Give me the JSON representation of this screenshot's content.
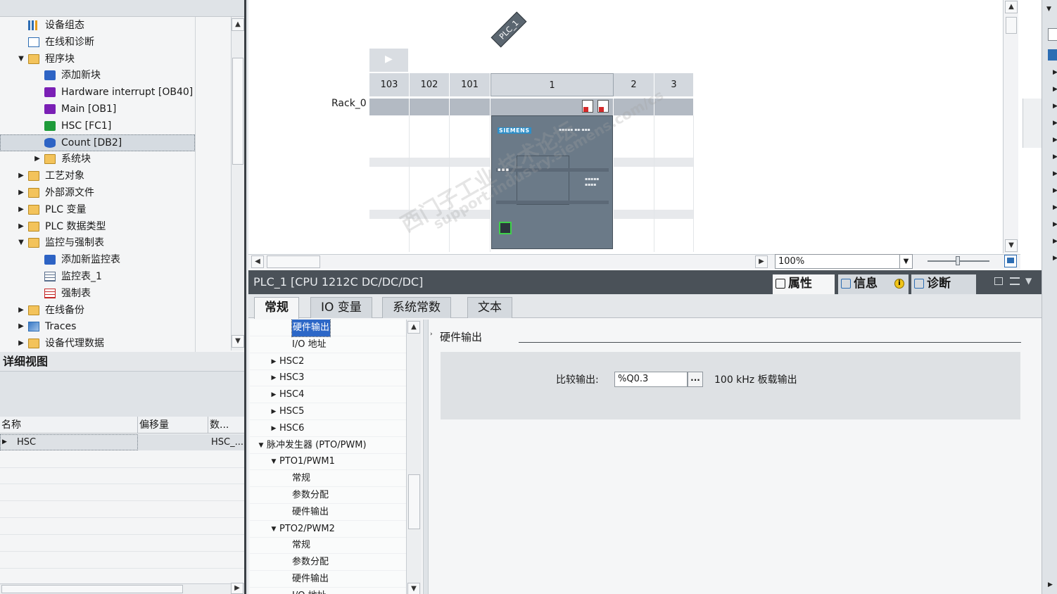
{
  "project_tree": {
    "items": [
      {
        "label": "设备组态",
        "icon": "device-configuration-icon"
      },
      {
        "label": "在线和诊断",
        "icon": "online-diagnostics-icon"
      },
      {
        "label": "程序块",
        "icon": "folder-icon",
        "expanded": true
      },
      {
        "label": "添加新块",
        "icon": "add-block-icon"
      },
      {
        "label": "Hardware interrupt [OB40]",
        "icon": "ob-block-icon"
      },
      {
        "label": "Main [OB1]",
        "icon": "ob-block-icon"
      },
      {
        "label": "HSC [FC1]",
        "icon": "fc-block-icon"
      },
      {
        "label": "Count [DB2]",
        "icon": "db-block-icon",
        "selected": true
      },
      {
        "label": "系统块",
        "icon": "folder-icon"
      },
      {
        "label": "工艺对象",
        "icon": "folder-icon"
      },
      {
        "label": "外部源文件",
        "icon": "folder-icon"
      },
      {
        "label": "PLC 变量",
        "icon": "folder-icon"
      },
      {
        "label": "PLC 数据类型",
        "icon": "folder-icon"
      },
      {
        "label": "监控与强制表",
        "icon": "folder-icon",
        "expanded": true
      },
      {
        "label": "添加新监控表",
        "icon": "add-watch-table-icon"
      },
      {
        "label": "监控表_1",
        "icon": "watch-table-icon"
      },
      {
        "label": "强制表",
        "icon": "force-table-icon"
      },
      {
        "label": "在线备份",
        "icon": "folder-icon"
      },
      {
        "label": "Traces",
        "icon": "traces-icon"
      },
      {
        "label": "设备代理数据",
        "icon": "folder-icon"
      }
    ]
  },
  "detail_view": {
    "title": "详细视图",
    "columns": [
      "名称",
      "偏移量",
      "数..."
    ],
    "rows": [
      {
        "name": "HSC",
        "offset": "",
        "data": "HSC_..."
      }
    ]
  },
  "device_view": {
    "plc_tag": "PLC_1",
    "rack_label": "Rack_0",
    "slots": [
      "103",
      "102",
      "101",
      "1",
      "2",
      "3"
    ],
    "cpu_brand": "SIEMENS",
    "zoom": "100%"
  },
  "inspector": {
    "title": "PLC_1 [CPU 1212C DC/DC/DC]",
    "panel_tabs": [
      "属性",
      "信息",
      "诊断"
    ],
    "sub_tabs": [
      "常规",
      "IO 变量",
      "系统常数",
      "文本"
    ],
    "nav_items": [
      {
        "label": "硬件输出",
        "level": 3,
        "selected": true
      },
      {
        "label": "I/O 地址",
        "level": 3
      },
      {
        "label": "HSC2",
        "level": 2,
        "toggle": "▶"
      },
      {
        "label": "HSC3",
        "level": 2,
        "toggle": "▶"
      },
      {
        "label": "HSC4",
        "level": 2,
        "toggle": "▶"
      },
      {
        "label": "HSC5",
        "level": 2,
        "toggle": "▶"
      },
      {
        "label": "HSC6",
        "level": 2,
        "toggle": "▶"
      },
      {
        "label": "脉冲发生器 (PTO/PWM)",
        "level": 1,
        "toggle": "▼"
      },
      {
        "label": "PTO1/PWM1",
        "level": 2,
        "toggle": "▼"
      },
      {
        "label": "常规",
        "level": 3
      },
      {
        "label": "参数分配",
        "level": 3
      },
      {
        "label": "硬件输出",
        "level": 3
      },
      {
        "label": "PTO2/PWM2",
        "level": 2,
        "toggle": "▼"
      },
      {
        "label": "常规",
        "level": 3
      },
      {
        "label": "参数分配",
        "level": 3
      },
      {
        "label": "硬件输出",
        "level": 3
      },
      {
        "label": "I/O 地址",
        "level": 3
      }
    ],
    "content": {
      "section_title": "硬件输出",
      "field_label": "比较输出:",
      "field_value": "%Q0.3",
      "field_button": "...",
      "field_description": "100 kHz 板载输出"
    }
  },
  "watermark": {
    "line1": "西门子工业  技术论坛",
    "line2": "support.industry.siemens.com/cs"
  },
  "colors": {
    "titlebar": "#4a5158",
    "selection": "#2c67c7",
    "panel": "#dee1e4",
    "rack_header": "#d3d8de"
  }
}
